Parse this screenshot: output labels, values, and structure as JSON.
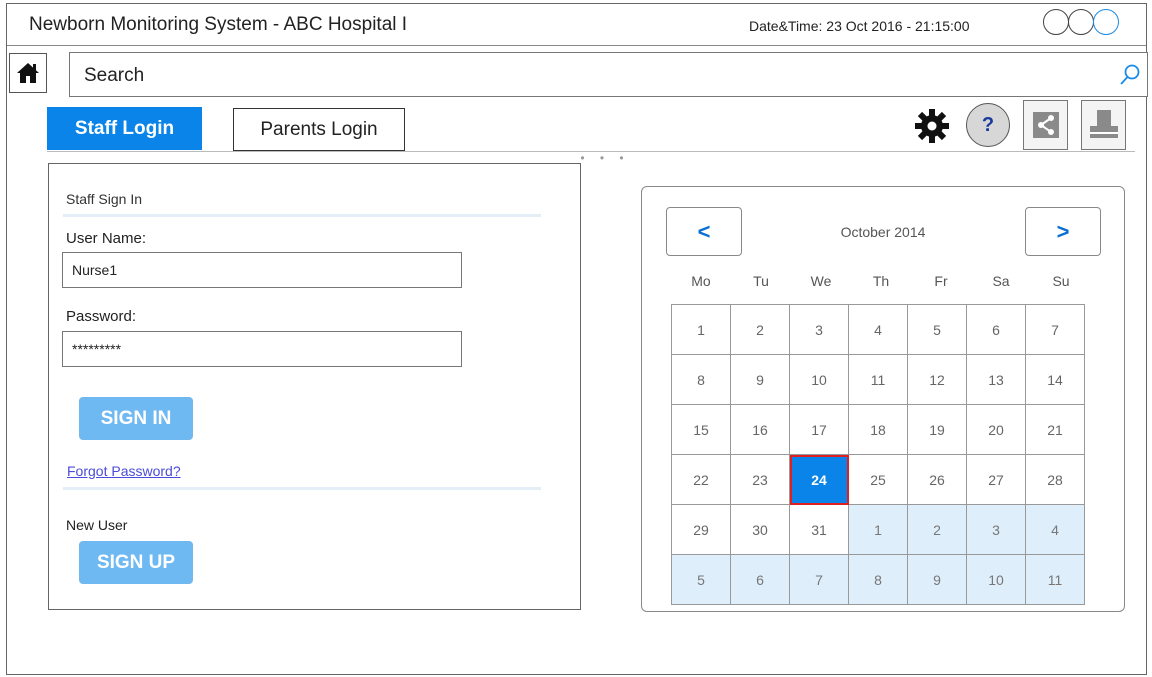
{
  "window": {
    "title": "Newborn Monitoring System - ABC Hospital I",
    "datetime": "Date&Time: 23 Oct 2016 - 21:15:00"
  },
  "search": {
    "placeholder": "Search"
  },
  "tabs": {
    "staff": "Staff Login",
    "parents": "Parents Login"
  },
  "toolbar": {
    "help": "?"
  },
  "login": {
    "heading": "Staff Sign In",
    "username_label": "User Name:",
    "username_value": "Nurse1",
    "password_label": "Password:",
    "password_value": "*********",
    "sign_in": "SIGN IN",
    "forgot": "Forgot Password?",
    "new_user": "New User",
    "sign_up": "SIGN UP"
  },
  "calendar": {
    "prev": "<",
    "next": ">",
    "month": "October 2014",
    "weekdays": [
      "Mo",
      "Tu",
      "We",
      "Th",
      "Fr",
      "Sa",
      "Su"
    ],
    "weeks": [
      [
        "1",
        "2",
        "3",
        "4",
        "5",
        "6",
        "7"
      ],
      [
        "8",
        "9",
        "10",
        "11",
        "12",
        "13",
        "14"
      ],
      [
        "15",
        "16",
        "17",
        "18",
        "19",
        "20",
        "21"
      ],
      [
        "22",
        "23",
        "24",
        "25",
        "26",
        "27",
        "28"
      ],
      [
        "29",
        "30",
        "31",
        "1",
        "2",
        "3",
        "4"
      ],
      [
        "5",
        "6",
        "7",
        "8",
        "9",
        "10",
        "11"
      ]
    ],
    "selected": "24"
  },
  "colors": {
    "accent": "#0a84e8",
    "button": "#6fb9f3",
    "selected_outline": "#e02020",
    "other_month": "#dfeefb"
  }
}
